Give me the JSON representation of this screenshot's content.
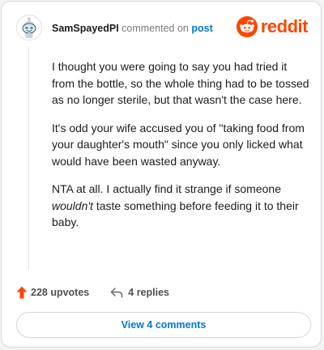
{
  "comment": {
    "username": "SamSpayedPI",
    "action_text": "commented on",
    "post_link_text": "post",
    "paragraphs": {
      "p1": "I thought you were going to say you had tried it from the bottle, so the whole thing had to be tossed as no longer sterile, but that wasn't the case here.",
      "p2": "It's odd your wife accused you of \"taking food from your daughter's mouth\" since you only licked what would have been wasted anyway.",
      "p3_before": "NTA at all. I actually find it strange if someone ",
      "p3_emphasis": "wouldn't",
      "p3_after": " taste something before feeding it to their baby."
    },
    "upvotes_label": "228 upvotes",
    "replies_label": "4 replies",
    "view_comments_label": "View 4 comments"
  },
  "branding": {
    "logo_text": "reddit",
    "logo_icon": "reddit-snoo-icon",
    "accent_color": "#ff4500",
    "link_color": "#0079d3"
  },
  "icons": {
    "avatar": "snoo-avatar-icon",
    "upvote": "upvote-arrow-icon",
    "reply": "reply-arrow-icon"
  }
}
